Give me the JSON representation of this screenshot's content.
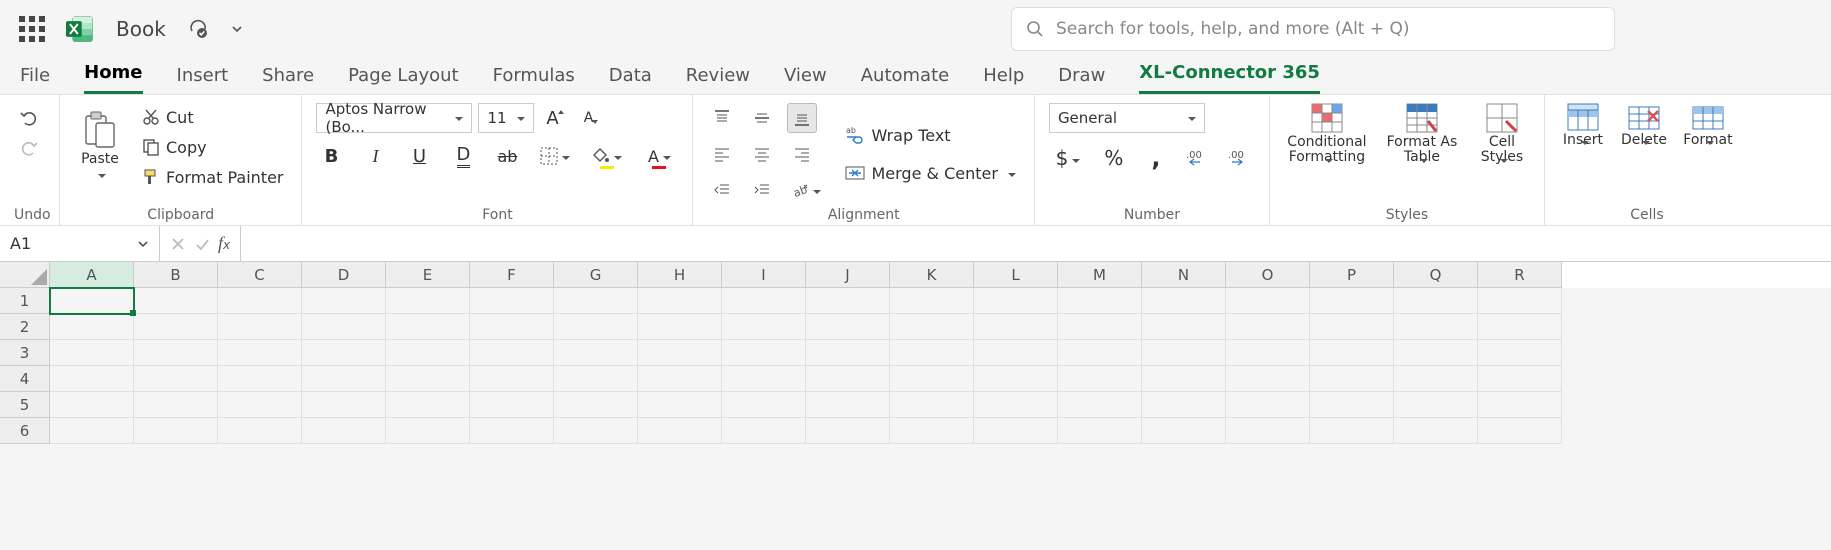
{
  "header": {
    "doc_title": "Book",
    "search_placeholder": "Search for tools, help, and more (Alt + Q)"
  },
  "tabs": [
    "File",
    "Home",
    "Insert",
    "Share",
    "Page Layout",
    "Formulas",
    "Data",
    "Review",
    "View",
    "Automate",
    "Help",
    "Draw",
    "XL-Connector 365"
  ],
  "active_tab": "Home",
  "secondary_active_tab": "XL-Connector 365",
  "ribbon": {
    "undo": {
      "label": "Undo"
    },
    "clipboard": {
      "paste": "Paste",
      "cut": "Cut",
      "copy": "Copy",
      "format_painter": "Format Painter",
      "group": "Clipboard"
    },
    "font": {
      "name": "Aptos Narrow (Bo...",
      "size": "11",
      "group": "Font"
    },
    "alignment": {
      "wrap": "Wrap Text",
      "merge": "Merge & Center",
      "group": "Alignment"
    },
    "number": {
      "format": "General",
      "group": "Number"
    },
    "styles": {
      "cond": "Conditional Formatting",
      "table": "Format As Table",
      "cell": "Cell Styles",
      "group": "Styles"
    },
    "cells": {
      "insert": "Insert",
      "delete": "Delete",
      "format": "Format",
      "group": "Cells"
    }
  },
  "formula_bar": {
    "name_box": "A1",
    "formula": ""
  },
  "grid": {
    "columns": [
      "A",
      "B",
      "C",
      "D",
      "E",
      "F",
      "G",
      "H",
      "I",
      "J",
      "K",
      "L",
      "M",
      "N",
      "O",
      "P",
      "Q",
      "R"
    ],
    "rows": [
      "1",
      "2",
      "3",
      "4",
      "5",
      "6"
    ],
    "selected_cell": "A1"
  }
}
